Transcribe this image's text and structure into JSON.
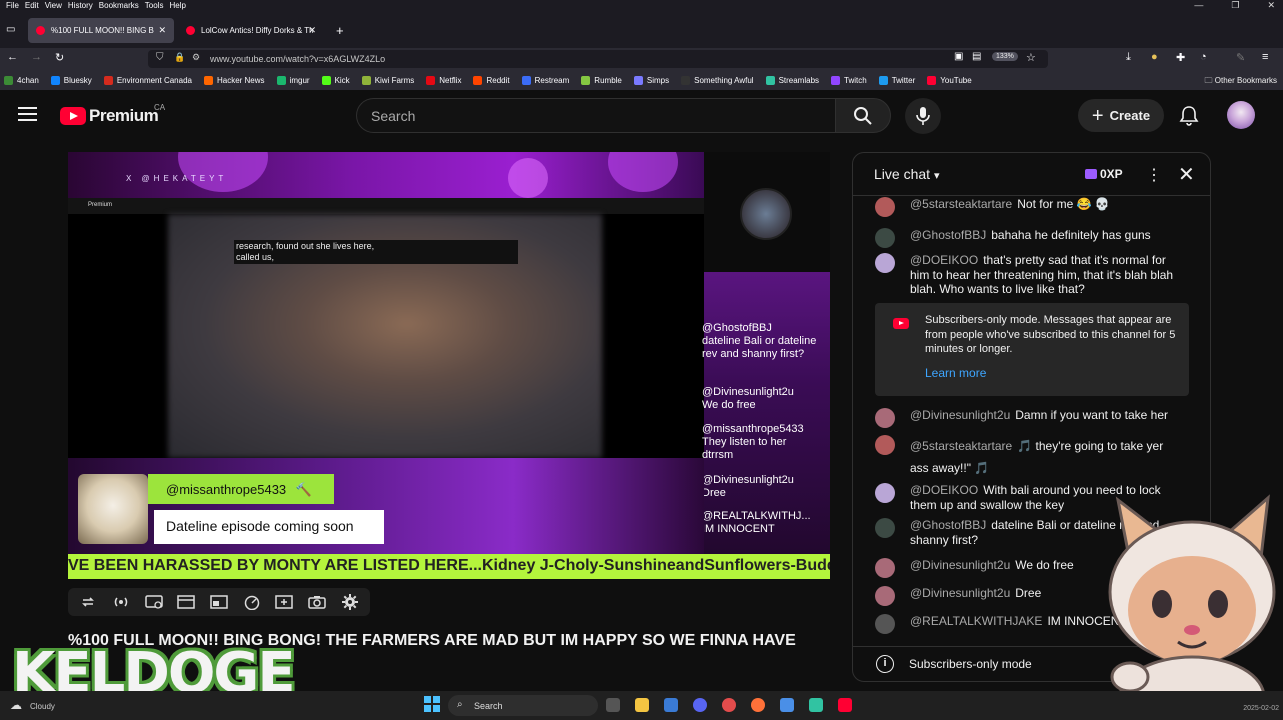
{
  "browser": {
    "menu": [
      "File",
      "Edit",
      "View",
      "History",
      "Bookmarks",
      "Tools",
      "Help"
    ],
    "tabs": [
      {
        "title": "%100 FULL MOON!! BING B",
        "active": true
      },
      {
        "title": "LolCow Antics! Diffy Dorks & Th",
        "active": false
      }
    ],
    "new_tab": "+",
    "url": "www.youtube.com/watch?v=x6AGLWZ4ZLo",
    "zoom": "133%",
    "bookmarks": [
      {
        "label": "4chan",
        "color": "#3c8b36"
      },
      {
        "label": "Bluesky",
        "color": "#1185fe"
      },
      {
        "label": "Environment Canada",
        "color": "#d52b1e"
      },
      {
        "label": "Hacker News",
        "color": "#ff6600"
      },
      {
        "label": "imgur",
        "color": "#1bb76e"
      },
      {
        "label": "Kick",
        "color": "#53fc18"
      },
      {
        "label": "Kiwi Farms",
        "color": "#8fb33a"
      },
      {
        "label": "Netflix",
        "color": "#e50914"
      },
      {
        "label": "Reddit",
        "color": "#ff4500"
      },
      {
        "label": "Restream",
        "color": "#3b6cf6"
      },
      {
        "label": "Rumble",
        "color": "#85c742"
      },
      {
        "label": "Simps",
        "color": "#7a7aff"
      },
      {
        "label": "Something Awful",
        "color": "#333333"
      },
      {
        "label": "Streamlabs",
        "color": "#31c3a2"
      },
      {
        "label": "Twitch",
        "color": "#9146ff"
      },
      {
        "label": "Twitter",
        "color": "#1d9bf0"
      },
      {
        "label": "YouTube",
        "color": "#ff0033"
      }
    ],
    "other_bookmarks": "Other Bookmarks"
  },
  "youtube": {
    "logo_text": "Premium",
    "region": "CA",
    "search_placeholder": "Search",
    "create_label": "Create",
    "title": "%100 FULL MOON!! BING BONG! THE FARMERS ARE MAD BUT IM HAPPY SO WE FINNA HAVE"
  },
  "video": {
    "overlay_handle": "X @HEKATEYT",
    "inner_logo": "Premium",
    "caption": "research, found out she lives here,\ncalled us,",
    "embedded_chat": [
      {
        "author": "@GhostofBBJ",
        "text": "dateline Bali or dateline rev and shanny first?"
      },
      {
        "author": "@Divinesunlight2u",
        "text": "We do free"
      },
      {
        "author": "@missanthrope5433",
        "text": "They listen to her dtrrsm"
      },
      {
        "author": "@Divinesunlight2u",
        "text": "Dree"
      },
      {
        "author": "@REALTALKWITHJ...",
        "text": "IM INNOCENT"
      }
    ],
    "highlight_handle": "@missanthrope5433",
    "highlight_message": "Dateline episode coming soon",
    "ticker": "VE BEEN HARASSED BY MONTY ARE LISTED HERE...Kidney J-Choly-SunshineandSunflowers-Buddha-Ve"
  },
  "overlay": {
    "brand": "KELDOGE"
  },
  "chat": {
    "title": "Live chat",
    "xp": "0XP",
    "messages": [
      {
        "author": "@5starsteaktartare",
        "text": "Not for me 😂 💀",
        "avatar": "#b25a5a"
      },
      {
        "author": "@GhostofBBJ",
        "text": "bahaha he definitely has guns",
        "avatar": "#3c4a44"
      },
      {
        "author": "@DOEIKOO",
        "text": "that's pretty sad that it's normal for him to hear her threatening him, that it's blah blah blah. Who wants to live like that?",
        "avatar": "#b9a6d6"
      },
      {
        "author": "@Divinesunlight2u",
        "text": "Damn if you want to take her",
        "avatar": "#a86a78"
      },
      {
        "author": "@5starsteaktartare",
        "text": "🎵 they're going to take yer ass away!!\" 🎵",
        "avatar": "#b25a5a"
      },
      {
        "author": "@DOEIKOO",
        "text": "With bali around you need to lock them up and swallow the key",
        "avatar": "#b9a6d6"
      },
      {
        "author": "@GhostofBBJ",
        "text": "dateline Bali or dateline rev and shanny first?",
        "avatar": "#3c4a44"
      },
      {
        "author": "@Divinesunlight2u",
        "text": "We do free",
        "avatar": "#a86a78"
      },
      {
        "author": "@Divinesunlight2u",
        "text": "Dree",
        "avatar": "#a86a78"
      },
      {
        "author": "@REALTALKWITHJAKE",
        "text": "IM INNOCENT",
        "avatar": "#555555"
      }
    ],
    "notice": "Subscribers-only mode. Messages that appear are from people who've subscribed to this channel for 5 minutes or longer.",
    "notice_link": "Learn more",
    "footer": "Subscribers-only mode"
  },
  "taskbar": {
    "weather": "Cloudy",
    "search": "Search",
    "date": "2025-02-02"
  }
}
